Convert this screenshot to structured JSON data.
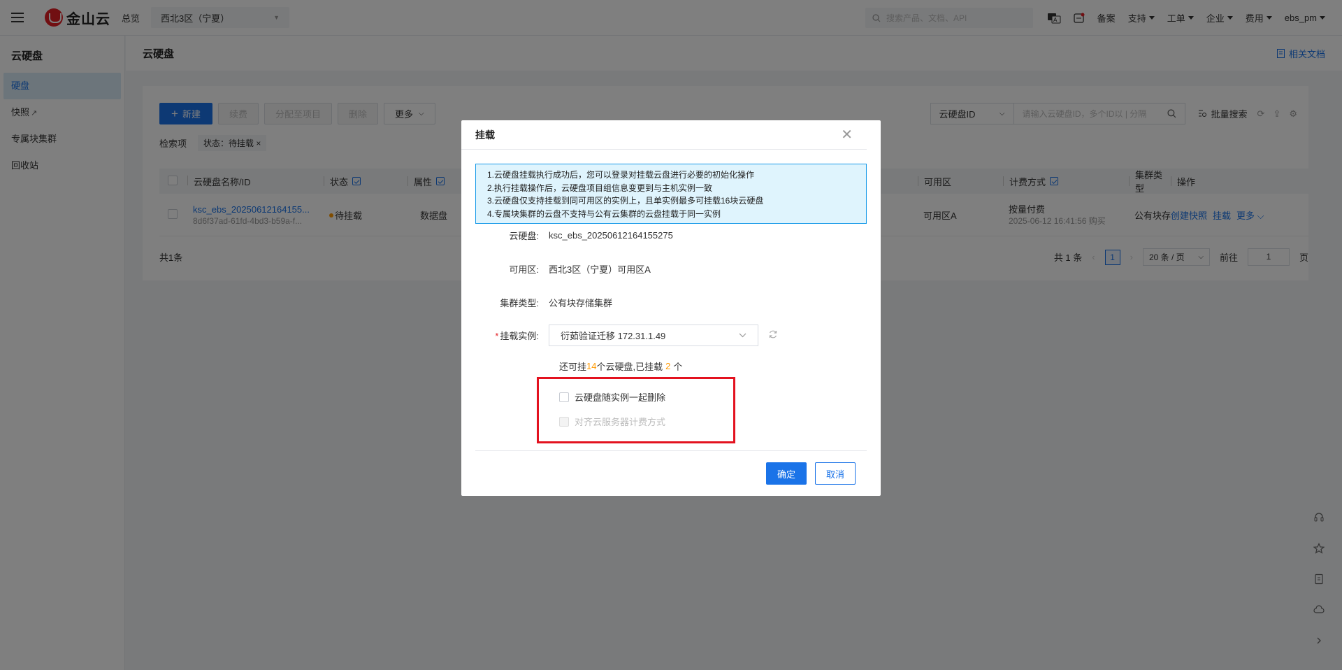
{
  "topbar": {
    "logo_text": "金山云",
    "overview": "总览",
    "region": "西北3区（宁夏）",
    "search_placeholder": "搜索产品、文档、API",
    "menu": [
      "备案",
      "支持",
      "工单",
      "企业",
      "费用"
    ],
    "user": "ebs_pm"
  },
  "sidebar": {
    "title": "云硬盘",
    "items": [
      "硬盘",
      "快照",
      "专属块集群",
      "回收站"
    ]
  },
  "main": {
    "title": "云硬盘",
    "docs_link": "相关文档",
    "toolbar": {
      "new": "新建",
      "renew": "续费",
      "assign": "分配至项目",
      "delete": "删除",
      "more": "更多"
    },
    "filter": {
      "label": "检索项",
      "tag": "状态：待挂载"
    },
    "search": {
      "field": "云硬盘ID",
      "placeholder": "请输入云硬盘ID，多个ID以 | 分隔",
      "batch": "批量搜索"
    },
    "table": {
      "headers": [
        "云硬盘名称/ID",
        "状态",
        "属性",
        "可用区",
        "计费方式",
        "集群类型",
        "操作"
      ],
      "row": {
        "name": "ksc_ebs_20250612164155...",
        "id": "8d6f37ad-61fd-4bd3-b59a-f...",
        "status": "待挂载",
        "attr": "数据盘",
        "zone": "可用区A",
        "billing": "按量付费",
        "billing_time": "2025-06-12 16:41:56 购买",
        "cluster": "公有块存",
        "actions": [
          "创建快照",
          "挂载",
          "更多"
        ]
      }
    },
    "pager": {
      "total_left": "共1条",
      "total_right": "共 1 条",
      "page": "1",
      "per_page": "20 条 / 页",
      "goto_label": "前往",
      "goto_value": "1",
      "page_suffix": "页"
    }
  },
  "modal": {
    "title": "挂载",
    "notice": [
      "1.云硬盘挂载执行成功后，您可以登录对挂载云盘进行必要的初始化操作",
      "2.执行挂载操作后，云硬盘项目组信息变更到与主机实例一致",
      "3.云硬盘仅支持挂载到同可用区的实例上，且单实例最多可挂载16块云硬盘",
      "4.专属块集群的云盘不支持与公有云集群的云盘挂载于同一实例"
    ],
    "fields": {
      "disk_label": "云硬盘:",
      "disk_value": "ksc_ebs_20250612164155275",
      "zone_label": "可用区:",
      "zone_value": "西北3区（宁夏）可用区A",
      "cluster_label": "集群类型:",
      "cluster_value": "公有块存储集群",
      "instance_label": "挂载实例:",
      "instance_value": "衍茹验证迁移 172.31.1.49"
    },
    "capacity": {
      "prefix": "还可挂",
      "remaining": "14",
      "middle": "个云硬盘,已挂载",
      "mounted": "2",
      "suffix": "个"
    },
    "checkbox_delete": "云硬盘随实例一起删除",
    "checkbox_billing": "对齐云服务器计费方式",
    "ok": "确定",
    "cancel": "取消"
  },
  "colors": {
    "primary": "#1a73e8",
    "highlight": "#e3121f",
    "warning": "#ff9900"
  }
}
